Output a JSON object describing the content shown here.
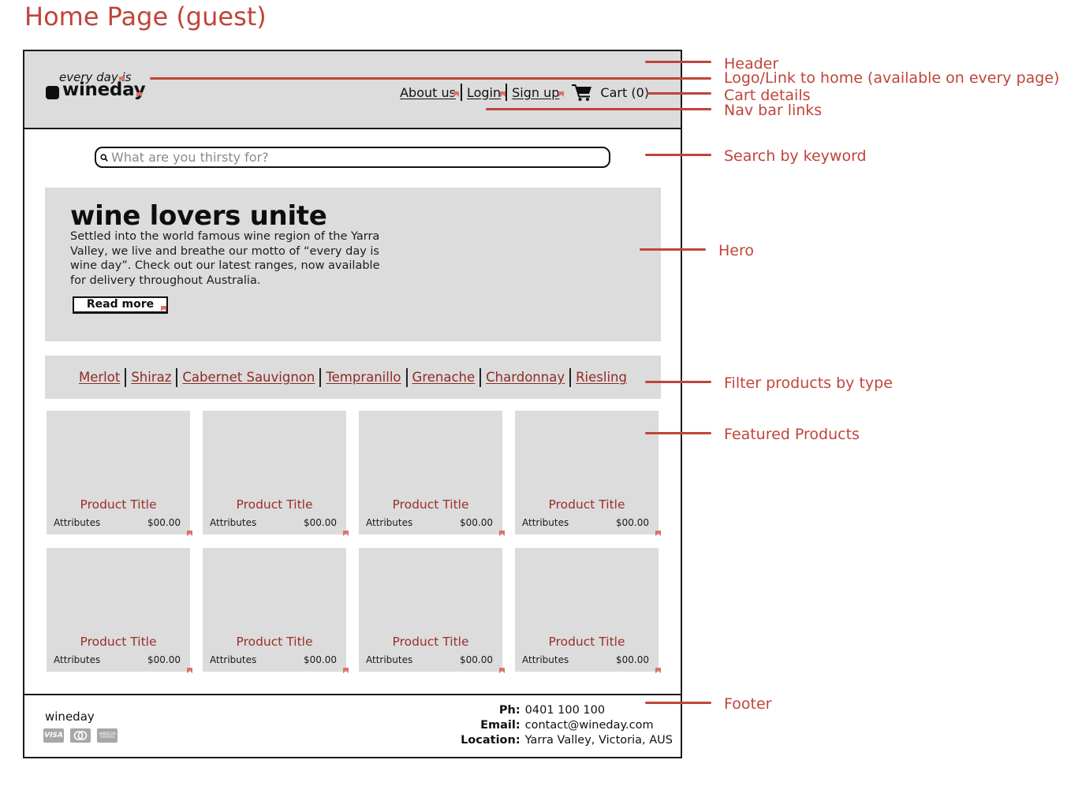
{
  "page_heading": "Home Page (guest)",
  "header": {
    "logo": {
      "tagline": "every day is",
      "wordmark": "wineday"
    },
    "nav_links": [
      {
        "label": "About us"
      },
      {
        "label": "Login"
      },
      {
        "label": "Sign up"
      }
    ],
    "cart": {
      "icon": "shopping-cart-icon",
      "label": "Cart (0)"
    }
  },
  "search": {
    "icon": "search-icon",
    "placeholder": "What are you thirsty for?",
    "value": ""
  },
  "hero": {
    "title": "wine lovers unite",
    "body": "Settled into the world famous wine region of the Yarra Valley, we live and breathe our motto of “every day is wine day”. Check out our latest ranges, now available for delivery throughout Australia.",
    "button_label": "Read more"
  },
  "filter": {
    "types": [
      "Merlot",
      "Shiraz",
      "Cabernet Sauvignon",
      "Tempranillo",
      "Grenache",
      "Chardonnay",
      "Riesling"
    ]
  },
  "products": [
    {
      "title": "Product Title",
      "attributes": "Attributes",
      "price": "$00.00"
    },
    {
      "title": "Product Title",
      "attributes": "Attributes",
      "price": "$00.00"
    },
    {
      "title": "Product Title",
      "attributes": "Attributes",
      "price": "$00.00"
    },
    {
      "title": "Product Title",
      "attributes": "Attributes",
      "price": "$00.00"
    },
    {
      "title": "Product Title",
      "attributes": "Attributes",
      "price": "$00.00"
    },
    {
      "title": "Product Title",
      "attributes": "Attributes",
      "price": "$00.00"
    },
    {
      "title": "Product Title",
      "attributes": "Attributes",
      "price": "$00.00"
    },
    {
      "title": "Product Title",
      "attributes": "Attributes",
      "price": "$00.00"
    }
  ],
  "footer": {
    "brand": "wineday",
    "payment_icons": [
      "visa-icon",
      "mastercard-icon",
      "american-express-icon"
    ],
    "visa_text": "VISA",
    "amex_text": "AMERICAN EXPRESS",
    "contact": [
      {
        "key": "Ph:",
        "value": "0401 100 100"
      },
      {
        "key": "Email:",
        "value": "contact@wineday.com"
      },
      {
        "key": "Location:",
        "value": "Yarra Valley, Victoria, AUS"
      }
    ]
  },
  "annotations": [
    {
      "label": "Header"
    },
    {
      "label": "Logo/Link to home (available on every page)"
    },
    {
      "label": "Cart details"
    },
    {
      "label": "Nav bar links"
    },
    {
      "label": "Search by keyword"
    },
    {
      "label": "Hero"
    },
    {
      "label": "Filter products by type"
    },
    {
      "label": "Featured Products"
    },
    {
      "label": "Footer"
    }
  ],
  "colors": {
    "annotation": "#c0443a",
    "product_title": "#9a2e27",
    "filter_link": "#8e2a24",
    "placeholder_fill": "#dcdcdc"
  }
}
